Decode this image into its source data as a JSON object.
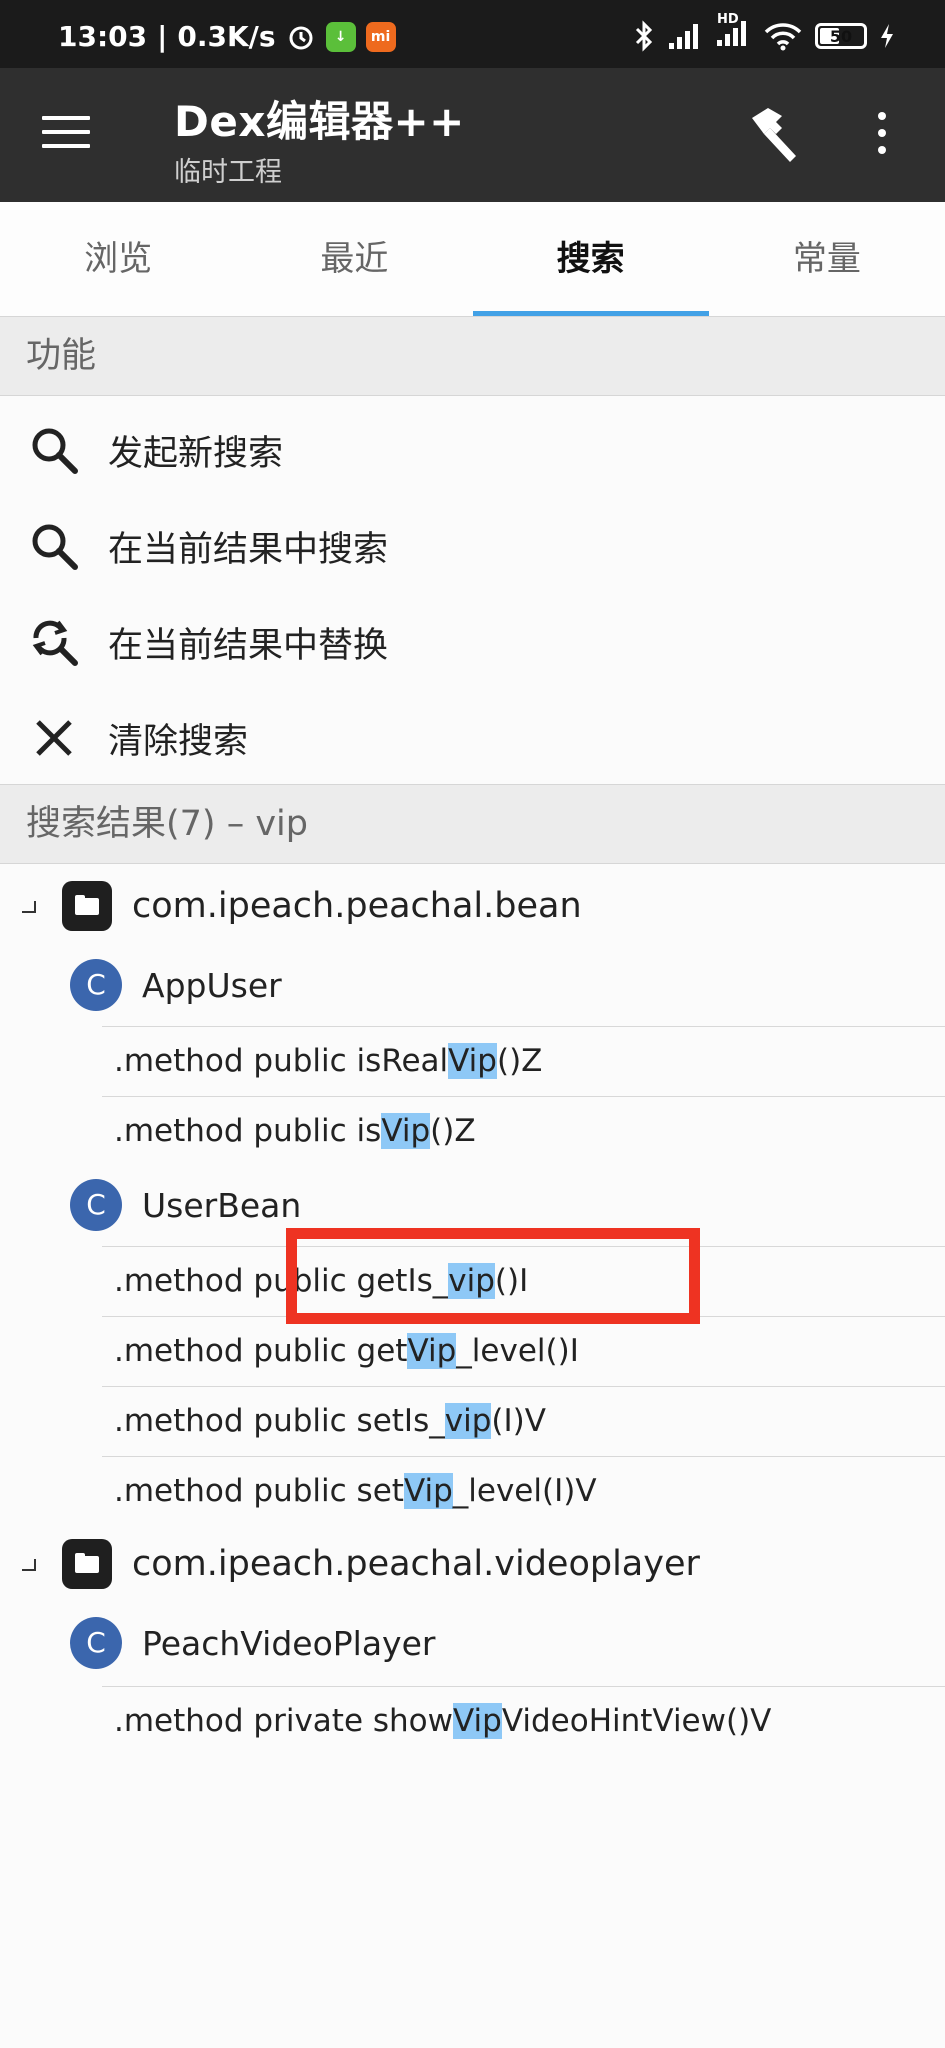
{
  "status_bar": {
    "time": "13:03",
    "speed": "0.3K/s",
    "battery": "50",
    "battery_level": 0.5,
    "network_label": "HD"
  },
  "app_bar": {
    "title": "Dex编辑器++",
    "subtitle": "临时工程"
  },
  "tabs": [
    {
      "label": "浏览",
      "active": false
    },
    {
      "label": "最近",
      "active": false
    },
    {
      "label": "搜索",
      "active": true
    },
    {
      "label": "常量",
      "active": false
    }
  ],
  "functions": {
    "header": "功能",
    "items": [
      {
        "label": "发起新搜索",
        "icon": "search-icon"
      },
      {
        "label": "在当前结果中搜索",
        "icon": "search-icon"
      },
      {
        "label": "在当前结果中替换",
        "icon": "search-replace-icon"
      },
      {
        "label": "清除搜索",
        "icon": "close-icon"
      }
    ]
  },
  "results": {
    "header": "搜索结果(7) – vip",
    "packages": [
      {
        "name": "com.ipeach.peachal.bean",
        "classes": [
          {
            "name": "AppUser",
            "methods": [
              {
                "pre": ".method public isReal",
                "hl": "Vip",
                "post": "()Z"
              },
              {
                "pre": ".method public is",
                "hl": "Vip",
                "post": "()Z"
              }
            ]
          },
          {
            "name": "UserBean",
            "methods": [
              {
                "pre": ".method public getIs_",
                "hl": "vip",
                "post": "()I"
              },
              {
                "pre": ".method public get",
                "hl": "Vip",
                "post": "_level()I"
              },
              {
                "pre": ".method public setIs_",
                "hl": "vip",
                "post": "(I)V"
              },
              {
                "pre": ".method public set",
                "hl": "Vip",
                "post": "_level(I)V"
              }
            ]
          }
        ]
      },
      {
        "name": "com.ipeach.peachal.videoplayer",
        "classes": [
          {
            "name": "PeachVideoPlayer",
            "methods": [
              {
                "pre": ".method private show",
                "hl": "Vip",
                "post": "VideoHintView()V"
              }
            ]
          }
        ]
      }
    ]
  },
  "class_badge": "C",
  "colors": {
    "accent": "#42a1e6",
    "highlight": "#8ec8f6",
    "class_badge": "#3b66ad",
    "annotation": "#ee3322",
    "app_bar": "#2f2f2f"
  }
}
